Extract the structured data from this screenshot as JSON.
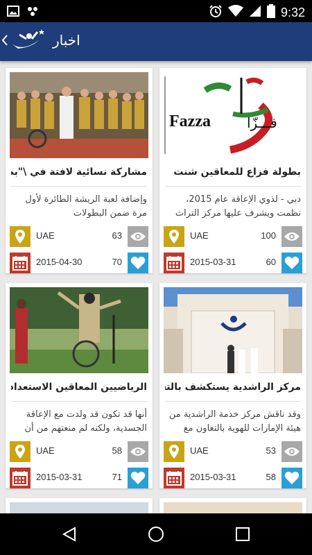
{
  "status_bar": {
    "time": "9:32"
  },
  "app_bar": {
    "title": "اخبار"
  },
  "colors": {
    "primary": "#1f3d7a",
    "location_icon_bg": "#c9a415",
    "calendar_icon_bg": "#c0392b",
    "views_icon_bg": "#a8a8a8",
    "likes_icon_bg": "#2a9fd6"
  },
  "cards": [
    {
      "title": "بطولة فزاع للمعاقين شنت",
      "desc": "دبي - لذوي الإعاقة عام 2015، نظمت ويشرف عليها مركز التراث حمدان بن",
      "location": "UAE",
      "date": "2015-03-31",
      "views": "100",
      "likes": "60",
      "image_text": "Fazza",
      "image_text_ar": "فـــزّا"
    },
    {
      "title": "مشاركة نسائية لافتة في \\\"بطولا...",
      "desc": "وإضافة لعبة الريشة الطائرة لأول مرة ضمن البطولات",
      "location": "UAE",
      "date": "2015-04-30",
      "views": "63",
      "likes": "70"
    },
    {
      "title": "مركز الراشدية يستكشف بالتعاون ...",
      "desc": "وقد ناقش مركز خدمة الراشدية من هيئة الإمارات للهوية بالتعاون مع نادي",
      "location": "UAE",
      "date": "2015-03-31",
      "views": "53",
      "likes": "58"
    },
    {
      "title": "الرياضيين المعاقين الاستعداد لبطو...",
      "desc": "أنها قد تكون قد ولدت مع الإعاقة الجسدية، ولكنه لم منعتهم من أن",
      "location": "UAE",
      "date": "2015-03-31",
      "views": "58",
      "likes": "71"
    }
  ]
}
